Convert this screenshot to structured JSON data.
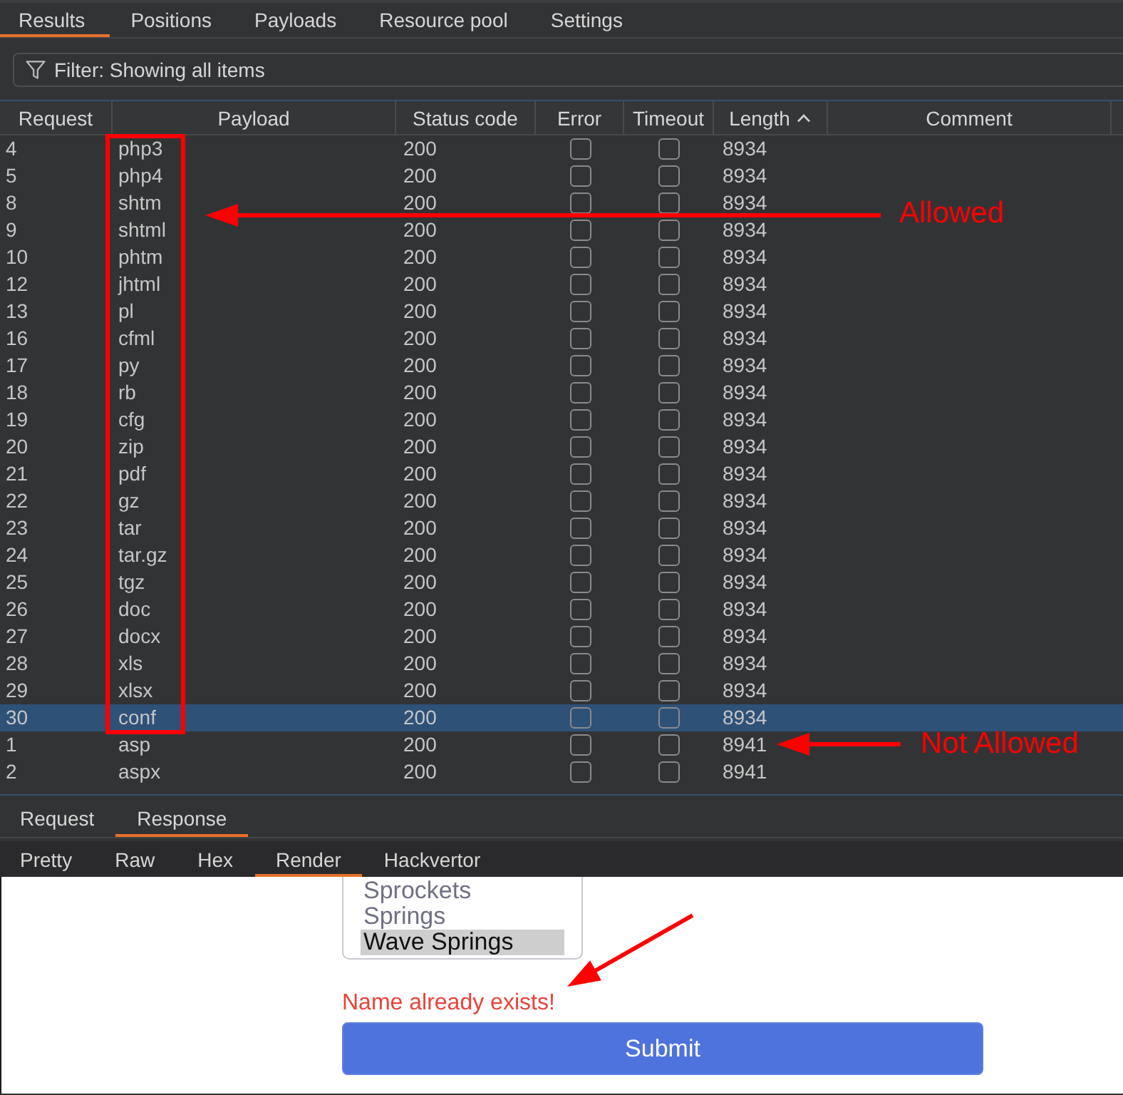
{
  "tabs": [
    {
      "label": "Results",
      "selected": true
    },
    {
      "label": "Positions",
      "selected": false
    },
    {
      "label": "Payloads",
      "selected": false
    },
    {
      "label": "Resource pool",
      "selected": false
    },
    {
      "label": "Settings",
      "selected": false
    }
  ],
  "filter": {
    "text": "Filter: Showing all items"
  },
  "table": {
    "columns": [
      {
        "label": "Request",
        "sorted": false
      },
      {
        "label": "Payload",
        "sorted": false
      },
      {
        "label": "Status code",
        "sorted": false
      },
      {
        "label": "Error",
        "sorted": false
      },
      {
        "label": "Timeout",
        "sorted": false
      },
      {
        "label": "Length",
        "sorted": true
      },
      {
        "label": "Comment",
        "sorted": false
      }
    ],
    "rows": [
      {
        "request": "4",
        "payload": "php3",
        "status_code": "200",
        "error": false,
        "timeout": false,
        "length": "8934",
        "selected": false
      },
      {
        "request": "5",
        "payload": "php4",
        "status_code": "200",
        "error": false,
        "timeout": false,
        "length": "8934",
        "selected": false
      },
      {
        "request": "8",
        "payload": "shtm",
        "status_code": "200",
        "error": false,
        "timeout": false,
        "length": "8934",
        "selected": false
      },
      {
        "request": "9",
        "payload": "shtml",
        "status_code": "200",
        "error": false,
        "timeout": false,
        "length": "8934",
        "selected": false
      },
      {
        "request": "10",
        "payload": "phtm",
        "status_code": "200",
        "error": false,
        "timeout": false,
        "length": "8934",
        "selected": false
      },
      {
        "request": "12",
        "payload": "jhtml",
        "status_code": "200",
        "error": false,
        "timeout": false,
        "length": "8934",
        "selected": false
      },
      {
        "request": "13",
        "payload": "pl",
        "status_code": "200",
        "error": false,
        "timeout": false,
        "length": "8934",
        "selected": false
      },
      {
        "request": "16",
        "payload": "cfml",
        "status_code": "200",
        "error": false,
        "timeout": false,
        "length": "8934",
        "selected": false
      },
      {
        "request": "17",
        "payload": "py",
        "status_code": "200",
        "error": false,
        "timeout": false,
        "length": "8934",
        "selected": false
      },
      {
        "request": "18",
        "payload": "rb",
        "status_code": "200",
        "error": false,
        "timeout": false,
        "length": "8934",
        "selected": false
      },
      {
        "request": "19",
        "payload": "cfg",
        "status_code": "200",
        "error": false,
        "timeout": false,
        "length": "8934",
        "selected": false
      },
      {
        "request": "20",
        "payload": "zip",
        "status_code": "200",
        "error": false,
        "timeout": false,
        "length": "8934",
        "selected": false
      },
      {
        "request": "21",
        "payload": "pdf",
        "status_code": "200",
        "error": false,
        "timeout": false,
        "length": "8934",
        "selected": false
      },
      {
        "request": "22",
        "payload": "gz",
        "status_code": "200",
        "error": false,
        "timeout": false,
        "length": "8934",
        "selected": false
      },
      {
        "request": "23",
        "payload": "tar",
        "status_code": "200",
        "error": false,
        "timeout": false,
        "length": "8934",
        "selected": false
      },
      {
        "request": "24",
        "payload": "tar.gz",
        "status_code": "200",
        "error": false,
        "timeout": false,
        "length": "8934",
        "selected": false
      },
      {
        "request": "25",
        "payload": "tgz",
        "status_code": "200",
        "error": false,
        "timeout": false,
        "length": "8934",
        "selected": false
      },
      {
        "request": "26",
        "payload": "doc",
        "status_code": "200",
        "error": false,
        "timeout": false,
        "length": "8934",
        "selected": false
      },
      {
        "request": "27",
        "payload": "docx",
        "status_code": "200",
        "error": false,
        "timeout": false,
        "length": "8934",
        "selected": false
      },
      {
        "request": "28",
        "payload": "xls",
        "status_code": "200",
        "error": false,
        "timeout": false,
        "length": "8934",
        "selected": false
      },
      {
        "request": "29",
        "payload": "xlsx",
        "status_code": "200",
        "error": false,
        "timeout": false,
        "length": "8934",
        "selected": false
      },
      {
        "request": "30",
        "payload": "conf",
        "status_code": "200",
        "error": false,
        "timeout": false,
        "length": "8934",
        "selected": true
      },
      {
        "request": "1",
        "payload": "asp",
        "status_code": "200",
        "error": false,
        "timeout": false,
        "length": "8941",
        "selected": false
      },
      {
        "request": "2",
        "payload": "aspx",
        "status_code": "200",
        "error": false,
        "timeout": false,
        "length": "8941",
        "selected": false
      }
    ]
  },
  "message_tabs": [
    {
      "label": "Request",
      "selected": false
    },
    {
      "label": "Response",
      "selected": true
    }
  ],
  "view_tabs": [
    {
      "label": "Pretty",
      "selected": false
    },
    {
      "label": "Raw",
      "selected": false
    },
    {
      "label": "Hex",
      "selected": false
    },
    {
      "label": "Render",
      "selected": true
    },
    {
      "label": "Hackvertor",
      "selected": false
    }
  ],
  "render": {
    "listbox": {
      "options": [
        {
          "label": "Sprockets",
          "selected": false
        },
        {
          "label": "Springs",
          "selected": false
        },
        {
          "label": "Wave Springs",
          "selected": true
        }
      ]
    },
    "error_message": "Name already exists!",
    "submit_button": "Submit"
  },
  "annotations": [
    {
      "kind": "frame"
    },
    {
      "kind": "arrow",
      "label": "Allowed"
    },
    {
      "kind": "arrow",
      "label": "Not Allowed"
    },
    {
      "kind": "arrow"
    }
  ]
}
